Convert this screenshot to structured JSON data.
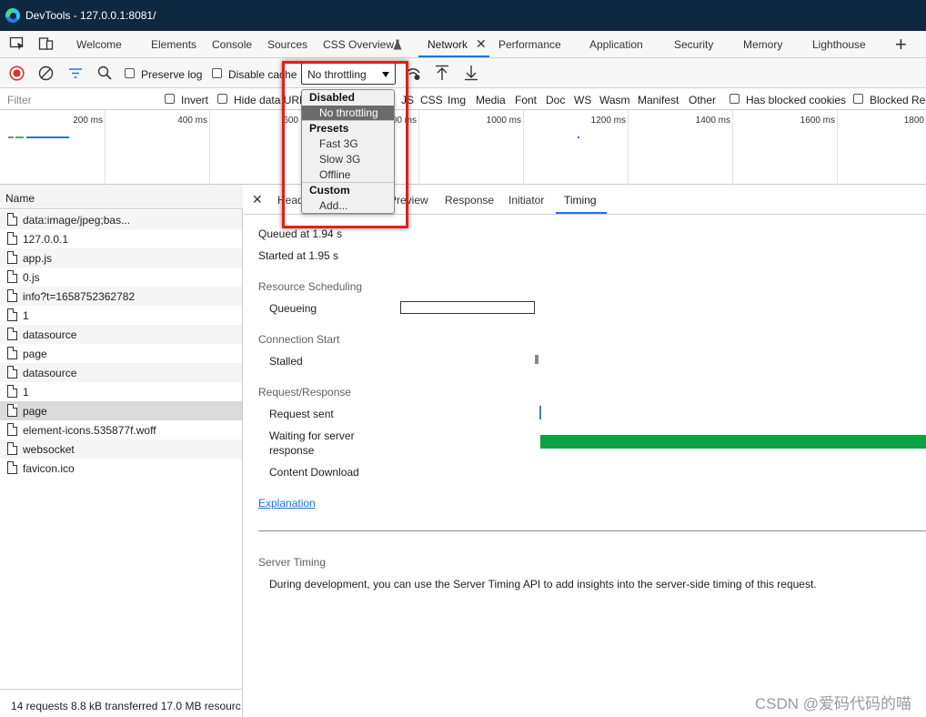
{
  "window": {
    "title": "DevTools - 127.0.0.1:8081/"
  },
  "tabs": [
    {
      "label": "Welcome"
    },
    {
      "label": "Elements"
    },
    {
      "label": "Console"
    },
    {
      "label": "Sources"
    },
    {
      "label": "CSS Overview"
    },
    {
      "label": "Network",
      "active": true
    },
    {
      "label": "Performance"
    },
    {
      "label": "Application"
    },
    {
      "label": "Security"
    },
    {
      "label": "Memory"
    },
    {
      "label": "Lighthouse"
    }
  ],
  "toolbar": {
    "preserve_log": "Preserve log",
    "disable_cache": "Disable cache",
    "throttling_value": "No throttling"
  },
  "filter": {
    "placeholder": "Filter",
    "invert": "Invert",
    "hide_data_urls": "Hide data URL",
    "types": [
      "JS",
      "CSS",
      "Img",
      "Media",
      "Font",
      "Doc",
      "WS",
      "Wasm",
      "Manifest",
      "Other"
    ],
    "has_blocked_cookies": "Has blocked cookies",
    "blocked_requests": "Blocked Rec"
  },
  "overview": {
    "ticks": [
      "200 ms",
      "400 ms",
      "600",
      "00 ms",
      "1000 ms",
      "1200 ms",
      "1400 ms",
      "1600 ms",
      "1800"
    ]
  },
  "requests": {
    "column": "Name",
    "items": [
      "data:image/jpeg;bas...",
      "127.0.0.1",
      "app.js",
      "0.js",
      "info?t=1658752362782",
      "1",
      "datasource",
      "page",
      "datasource",
      "1",
      "page",
      "element-icons.535877f.woff",
      "websocket",
      "favicon.ico"
    ],
    "selected_index": 10,
    "status": "14 requests  8.8 kB transferred  17.0 MB resourc"
  },
  "detail_tabs": [
    "Head",
    "Preview",
    "Response",
    "Initiator",
    "Timing"
  ],
  "timing": {
    "queued": "Queued at 1.94 s",
    "started": "Started at 1.95 s",
    "resource_scheduling": "Resource Scheduling",
    "queueing": "Queueing",
    "connection_start": "Connection Start",
    "stalled": "Stalled",
    "request_response": "Request/Response",
    "request_sent": "Request sent",
    "waiting_line1": "Waiting for server",
    "waiting_line2": "response",
    "content_download": "Content Download",
    "explanation": "Explanation",
    "server_timing": "Server Timing",
    "server_timing_desc": "During development, you can use the Server Timing API to add insights into the server-side timing of this request."
  },
  "throttle_menu": {
    "disabled_header": "Disabled",
    "no_throttling": "No throttling",
    "presets_header": "Presets",
    "fast3g": "Fast 3G",
    "slow3g": "Slow 3G",
    "offline": "Offline",
    "custom_header": "Custom",
    "add": "Add..."
  },
  "watermark": "CSDN @爱码代码的喵",
  "colors": {
    "titlebar": "#0f2841",
    "accent": "#1a73e8",
    "record": "#d93025",
    "waiting_bar": "#0aa244",
    "highlight": "#e0201c"
  }
}
